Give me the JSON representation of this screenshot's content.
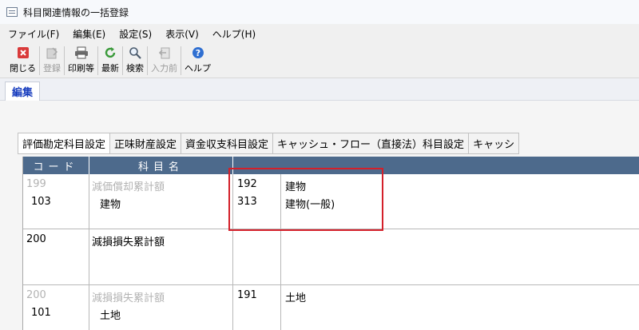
{
  "window": {
    "title": "科目関連情報の一括登録"
  },
  "menu": [
    {
      "label": "ファイル(F)"
    },
    {
      "label": "編集(E)"
    },
    {
      "label": "設定(S)"
    },
    {
      "label": "表示(V)"
    },
    {
      "label": "ヘルプ(H)"
    }
  ],
  "toolbar": {
    "close": "閉じる",
    "register": "登録",
    "print": "印刷等",
    "refresh": "最新",
    "search": "検索",
    "prev_input": "入力前",
    "help": "ヘルプ"
  },
  "edit_tab": "編集",
  "tabs": [
    "評価勘定科目設定",
    "正味財産設定",
    "資金収支科目設定",
    "キャッシュ・フロー（直接法）科目設定",
    "キャッシ"
  ],
  "grid": {
    "headers": {
      "code": "コード",
      "name": "科目名"
    },
    "rows": [
      {
        "code_top": "199",
        "name_top": "減価償却累計額",
        "code_main": "103",
        "name_main": "建物",
        "links": [
          {
            "code": "192",
            "name": "建物"
          },
          {
            "code": "313",
            "name": "建物(一般)"
          }
        ]
      },
      {
        "code_top": "",
        "name_top": "",
        "code_main": "200",
        "name_main": "減損損失累計額",
        "links": []
      },
      {
        "code_top": "200",
        "name_top": "減損損失累計額",
        "code_main": "101",
        "name_main": "土地",
        "links": [
          {
            "code": "191",
            "name": "土地"
          }
        ]
      }
    ]
  },
  "colors": {
    "header_bg": "#4d6a8c",
    "highlight": "#d4202a",
    "edit_tab_text": "#1a3fbf"
  }
}
